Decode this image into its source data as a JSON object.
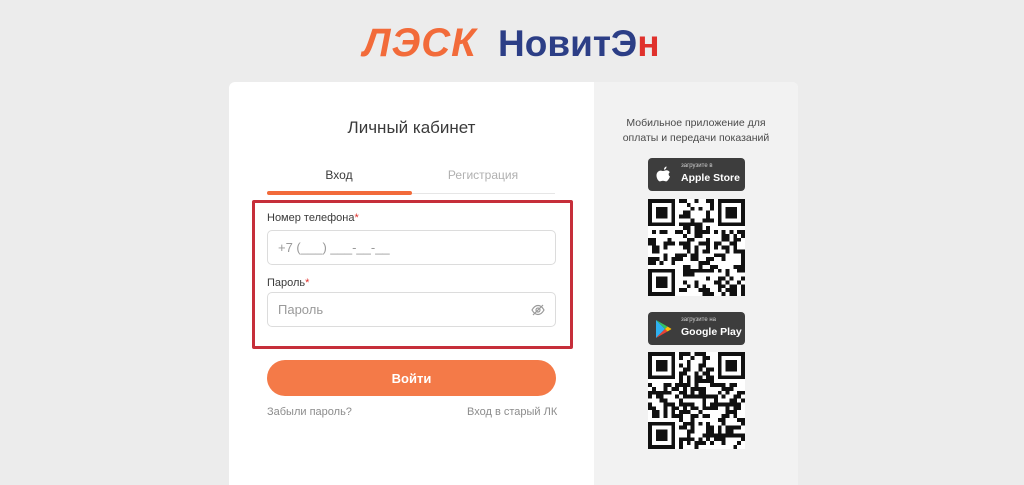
{
  "logos": {
    "lesk": "ЛЭСК",
    "novit_main": "НовитЭ",
    "novit_tail": "н"
  },
  "login": {
    "title": "Личный кабинет",
    "tabs": [
      {
        "label": "Вход",
        "active": true
      },
      {
        "label": "Регистрация",
        "active": false
      }
    ],
    "phone": {
      "label": "Номер телефона",
      "required_mark": "*",
      "placeholder": "+7 (___) ___-__-__"
    },
    "password": {
      "label": "Пароль",
      "required_mark": "*",
      "placeholder": "Пароль",
      "toggle_icon": "eye-off-icon"
    },
    "submit_label": "Войти",
    "forgot_link": "Забыли пароль?",
    "old_link": "Вход в старый ЛК"
  },
  "mobile": {
    "title_line1": "Мобильное приложение для",
    "title_line2": "оплаты и передачи показаний",
    "apple": {
      "small": "загрузите в",
      "big": "Apple Store",
      "icon": "apple-icon"
    },
    "google": {
      "small": "загрузите на",
      "big": "Google Play",
      "icon": "google-play-icon"
    }
  },
  "colors": {
    "accent": "#f47a48",
    "highlight": "#c62e3a",
    "brand_blue": "#2c3e86",
    "brand_red": "#e0312c"
  }
}
